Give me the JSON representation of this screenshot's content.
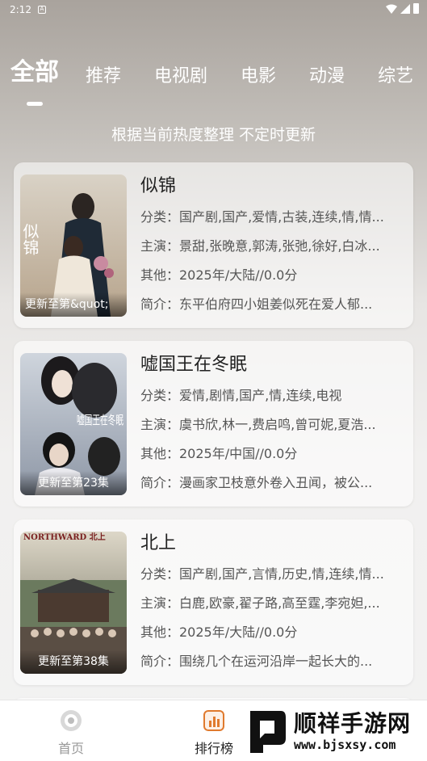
{
  "status": {
    "time": "2:12",
    "notif": "A"
  },
  "tabs": [
    "全部",
    "推荐",
    "电视剧",
    "电影",
    "动漫",
    "综艺"
  ],
  "subtitle": "根据当前热度整理 不定时更新",
  "cards": [
    {
      "title": "似锦",
      "caption": "更新至第&quot;",
      "category": "分类：国产剧,国产,爱情,古装,连续,情,情...",
      "cast": "主演：景甜,张晚意,郭涛,张弛,徐好,白冰...",
      "other": "其他：2025年/大陆//0.0分",
      "summary": "简介：东平伯府四小姐姜似死在爱人郁...",
      "poster_text": "似锦"
    },
    {
      "title": "嘘国王在冬眠",
      "caption": "更新至第23集",
      "category": "分类：爱情,剧情,国产,情,连续,电视",
      "cast": "主演：虞书欣,林一,费启鸣,曾可妮,夏浩...",
      "other": "其他：2025年/中国//0.0分",
      "summary": "简介：漫画家卫枝意外卷入丑闻，被公...",
      "poster_text": "嘘国王在冬眠"
    },
    {
      "title": "北上",
      "caption": "更新至第38集",
      "category": "分类：国产剧,国产,言情,历史,情,连续,情...",
      "cast": "主演：白鹿,欧豪,翟子路,高至霆,李宛妲,...",
      "other": "其他：2025年/大陆//0.0分",
      "summary": "简介：围绕几个在运河沿岸一起长大的...",
      "poster_text": "NORTHWARD 北上"
    }
  ],
  "nav": {
    "home": "首页",
    "rank": "排行榜"
  },
  "watermark": {
    "cn": "顺祥手游网",
    "url": "www.bjsxsy.com"
  },
  "colors": {
    "accent": "#e07a2e",
    "nav_active": "#222222",
    "nav_inactive": "#999999"
  }
}
